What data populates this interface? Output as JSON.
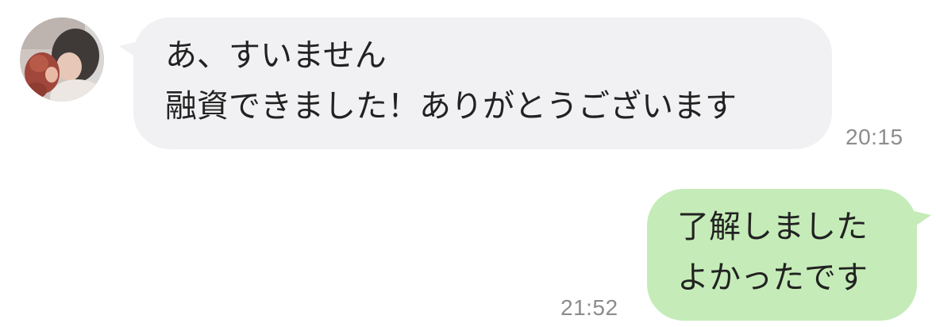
{
  "conversation": {
    "incoming": {
      "avatar_icon": "user-avatar-photo",
      "lines": [
        "あ、すいません",
        "融資できました！ありがとうございます"
      ],
      "time": "20:15",
      "bubble_color": "#f1f1f3"
    },
    "outgoing": {
      "lines": [
        "了解しました",
        "よかったです"
      ],
      "time": "21:52",
      "bubble_color": "#c5ecb8"
    }
  },
  "colors": {
    "background": "#ffffff",
    "text": "#222222",
    "timestamp": "#8c8c8c"
  }
}
